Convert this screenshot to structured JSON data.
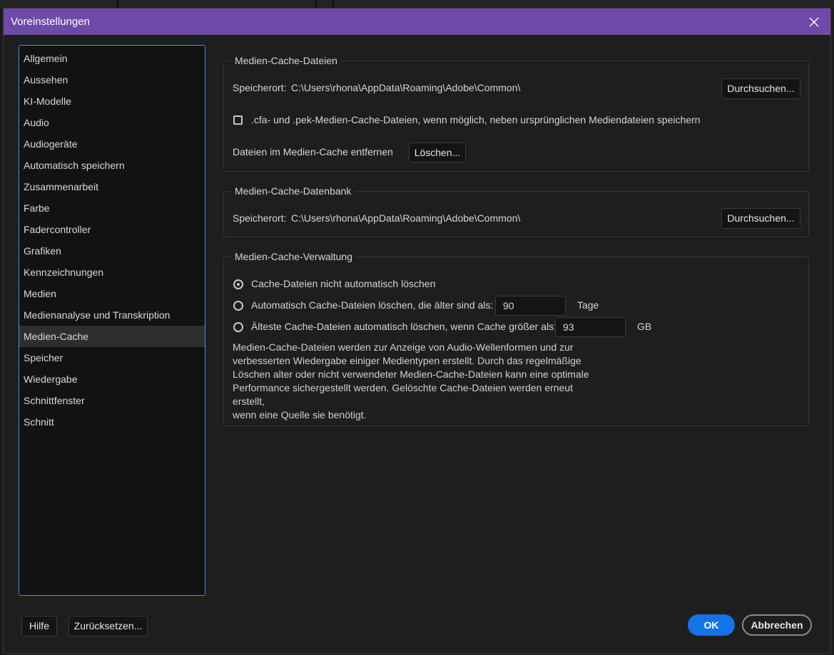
{
  "window": {
    "title": "Voreinstellungen"
  },
  "sidebar": {
    "items": [
      {
        "label": "Allgemein"
      },
      {
        "label": "Aussehen"
      },
      {
        "label": "KI-Modelle"
      },
      {
        "label": "Audio"
      },
      {
        "label": "Audiogeräte"
      },
      {
        "label": "Automatisch speichern"
      },
      {
        "label": "Zusammenarbeit"
      },
      {
        "label": "Farbe"
      },
      {
        "label": "Fadercontroller"
      },
      {
        "label": "Grafiken"
      },
      {
        "label": "Kennzeichnungen"
      },
      {
        "label": "Medien"
      },
      {
        "label": "Medienanalyse und Transkription"
      },
      {
        "label": "Medien-Cache"
      },
      {
        "label": "Speicher"
      },
      {
        "label": "Wiedergabe"
      },
      {
        "label": "Schnittfenster"
      },
      {
        "label": "Schnitt"
      }
    ],
    "selected": "Medien-Cache"
  },
  "cache_files": {
    "title": "Medien-Cache-Dateien",
    "location_label": "Speicherort:",
    "location_path": "C:\\Users\\rhona\\AppData\\Roaming\\Adobe\\Common\\",
    "browse_label": "Durchsuchen...",
    "checkbox_label": ".cfa- und .pek-Medien-Cache-Dateien, wenn möglich, neben ursprünglichen Mediendateien speichern",
    "checkbox_checked": false,
    "remove_label": "Dateien im Medien-Cache entfernen",
    "delete_label": "Löschen..."
  },
  "cache_db": {
    "title": "Medien-Cache-Datenbank",
    "location_label": "Speicherort:",
    "location_path": "C:\\Users\\rhona\\AppData\\Roaming\\Adobe\\Common\\",
    "browse_label": "Durchsuchen..."
  },
  "cache_mgmt": {
    "title": "Medien-Cache-Verwaltung",
    "option1": "Cache-Dateien nicht automatisch löschen",
    "option2": "Automatisch Cache-Dateien löschen, die älter sind als:",
    "option2_value": "90",
    "option2_unit": "Tage",
    "option3": "Älteste Cache-Dateien automatisch löschen, wenn Cache größer als:",
    "option3_value": "93",
    "option3_unit": "GB",
    "selected_option": 1,
    "description": "Medien-Cache-Dateien werden zur Anzeige von Audio-Wellenformen und zur\nverbesserten Wiedergabe einiger Medientypen erstellt. Durch das regelmäßige\nLöschen alter oder nicht verwendeter Medien-Cache-Dateien kann eine optimale\nPerformance sichergestellt werden. Gelöschte Cache-Dateien werden erneut erstellt,\nwenn eine Quelle sie benötigt."
  },
  "footer": {
    "help_label": "Hilfe",
    "reset_label": "Zurücksetzen...",
    "ok_label": "OK",
    "cancel_label": "Abbrechen"
  },
  "colors": {
    "titlebar": "#6e4aa8",
    "accent": "#1473e6",
    "sidebar_border": "#4a90d9",
    "background": "#1e1e1e"
  }
}
